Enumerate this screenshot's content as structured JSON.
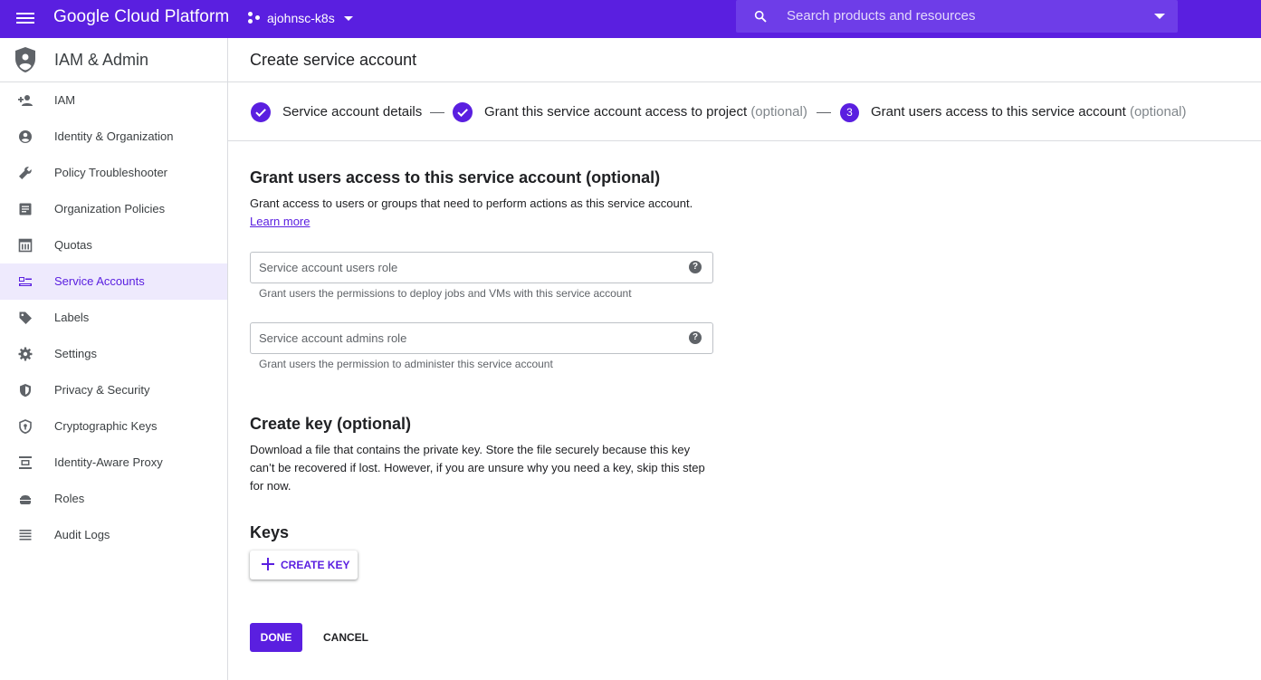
{
  "topbar": {
    "brand": "Google Cloud Platform",
    "project": "ajohnsc-k8s",
    "search_placeholder": "Search products and resources",
    "accent_color": "#5a1fe0"
  },
  "sidebar": {
    "title": "IAM & Admin",
    "items": [
      {
        "label": "IAM",
        "icon": "person-add-icon"
      },
      {
        "label": "Identity & Organization",
        "icon": "account-circle-icon"
      },
      {
        "label": "Policy Troubleshooter",
        "icon": "wrench-icon"
      },
      {
        "label": "Organization Policies",
        "icon": "document-list-icon"
      },
      {
        "label": "Quotas",
        "icon": "quota-icon"
      },
      {
        "label": "Service Accounts",
        "icon": "service-account-icon",
        "active": true
      },
      {
        "label": "Labels",
        "icon": "label-tag-icon"
      },
      {
        "label": "Settings",
        "icon": "gear-icon"
      },
      {
        "label": "Privacy & Security",
        "icon": "shield-icon"
      },
      {
        "label": "Cryptographic Keys",
        "icon": "security-shield-icon"
      },
      {
        "label": "Identity-Aware Proxy",
        "icon": "proxy-icon"
      },
      {
        "label": "Roles",
        "icon": "roles-icon"
      },
      {
        "label": "Audit Logs",
        "icon": "list-lines-icon"
      }
    ]
  },
  "main": {
    "page_title": "Create service account",
    "steps": [
      {
        "label": "Service account details",
        "optional": "",
        "status": "complete"
      },
      {
        "label": "Grant this service account access to project",
        "optional": "(optional)",
        "status": "complete"
      },
      {
        "number": "3",
        "label": "Grant users access to this service account",
        "optional": "(optional)",
        "status": "current"
      }
    ],
    "grant_section": {
      "heading": "Grant users access to this service account (optional)",
      "description": "Grant access to users or groups that need to perform actions as this service account.",
      "learn_more": "Learn more",
      "users_role_placeholder": "Service account users role",
      "users_role_hint": "Grant users the permissions to deploy jobs and VMs with this service account",
      "admins_role_placeholder": "Service account admins role",
      "admins_role_hint": "Grant users the permission to administer this service account"
    },
    "key_section": {
      "heading": "Create key (optional)",
      "description": "Download a file that contains the private key. Store the file securely because this key can’t be recovered if lost. However, if you are unsure why you need a key, skip this step for now.",
      "keys_heading": "Keys",
      "create_key_label": "CREATE KEY"
    },
    "actions": {
      "done_label": "DONE",
      "cancel_label": "CANCEL"
    }
  }
}
